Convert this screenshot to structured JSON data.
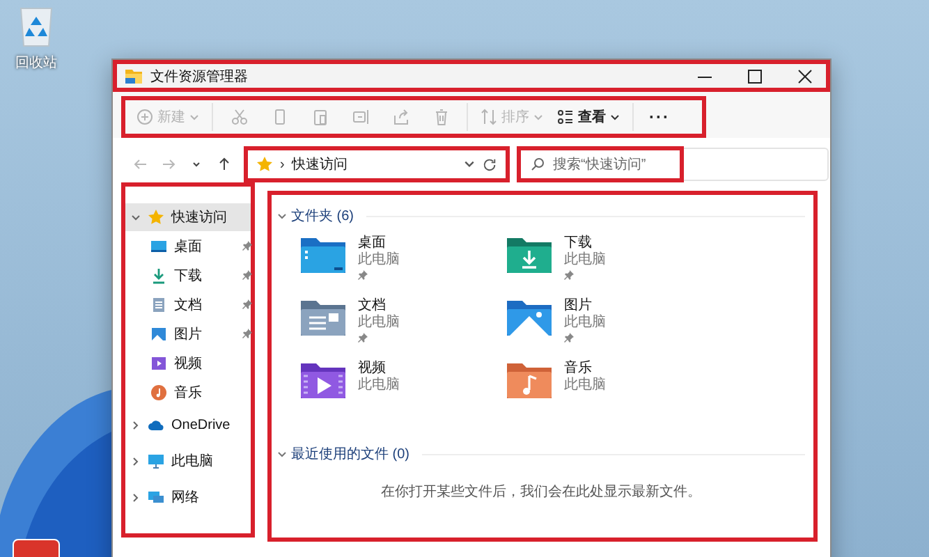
{
  "desktop": {
    "icons": [
      {
        "label": "回收站",
        "kind": "recycle_bin"
      }
    ]
  },
  "window": {
    "title": "文件资源管理器",
    "highlighted": true
  },
  "toolbar": {
    "highlighted": true,
    "items": [
      {
        "kind": "new",
        "label": "新建",
        "disabled": true,
        "dropdown": true
      },
      {
        "kind": "separator"
      },
      {
        "kind": "cut",
        "disabled": true
      },
      {
        "kind": "copy",
        "disabled": true
      },
      {
        "kind": "paste",
        "disabled": true
      },
      {
        "kind": "rename",
        "disabled": true
      },
      {
        "kind": "share",
        "disabled": true
      },
      {
        "kind": "delete",
        "disabled": true
      },
      {
        "kind": "separator"
      },
      {
        "kind": "sort",
        "label": "排序",
        "disabled": true,
        "dropdown": true
      },
      {
        "kind": "view",
        "label": "查看",
        "disabled": false,
        "dropdown": true
      },
      {
        "kind": "separator"
      },
      {
        "kind": "more",
        "label": "···",
        "disabled": false
      }
    ]
  },
  "navigation": {
    "buttons": [
      {
        "kind": "back",
        "disabled": true
      },
      {
        "kind": "forward",
        "disabled": true
      },
      {
        "kind": "recent",
        "disabled": false
      },
      {
        "kind": "up",
        "disabled": false
      }
    ]
  },
  "address_bar": {
    "highlighted": true,
    "separator": "›",
    "path": "快速访问"
  },
  "search": {
    "highlighted": true,
    "placeholder": "搜索“快速访问”"
  },
  "sidebar": {
    "highlighted": true,
    "items": [
      {
        "label": "快速访问",
        "kind": "star",
        "expanded": true,
        "selected": true,
        "children": [
          {
            "label": "桌面",
            "kind": "desktop",
            "pinned": true,
            "selected": false
          },
          {
            "label": "下载",
            "kind": "downloads",
            "pinned": true,
            "selected": false
          },
          {
            "label": "文档",
            "kind": "documents",
            "pinned": true,
            "selected": false
          },
          {
            "label": "图片",
            "kind": "pictures",
            "pinned": true,
            "selected": false
          },
          {
            "label": "视频",
            "kind": "videos",
            "pinned": false,
            "selected": false
          },
          {
            "label": "音乐",
            "kind": "music",
            "pinned": false,
            "selected": false
          }
        ]
      },
      {
        "label": "OneDrive",
        "kind": "cloud",
        "expanded": false,
        "selected": false
      },
      {
        "label": "此电脑",
        "kind": "pc",
        "expanded": false,
        "selected": false
      },
      {
        "label": "网络",
        "kind": "network",
        "expanded": false,
        "selected": false
      }
    ]
  },
  "content": {
    "highlighted": true,
    "sections": [
      {
        "title": "文件夹 (6)",
        "expanded": true,
        "items": [
          {
            "name": "桌面",
            "location": "此电脑",
            "kind": "desktop",
            "pinned": true
          },
          {
            "name": "下载",
            "location": "此电脑",
            "kind": "downloads",
            "pinned": true
          },
          {
            "name": "文档",
            "location": "此电脑",
            "kind": "documents",
            "pinned": true
          },
          {
            "name": "图片",
            "location": "此电脑",
            "kind": "pictures",
            "pinned": true
          },
          {
            "name": "视频",
            "location": "此电脑",
            "kind": "videos",
            "pinned": false
          },
          {
            "name": "音乐",
            "location": "此电脑",
            "kind": "music",
            "pinned": false
          }
        ]
      },
      {
        "title": "最近使用的文件 (0)",
        "expanded": true,
        "message": "在你打开某些文件后，我们会在此处显示最新文件。"
      }
    ]
  }
}
